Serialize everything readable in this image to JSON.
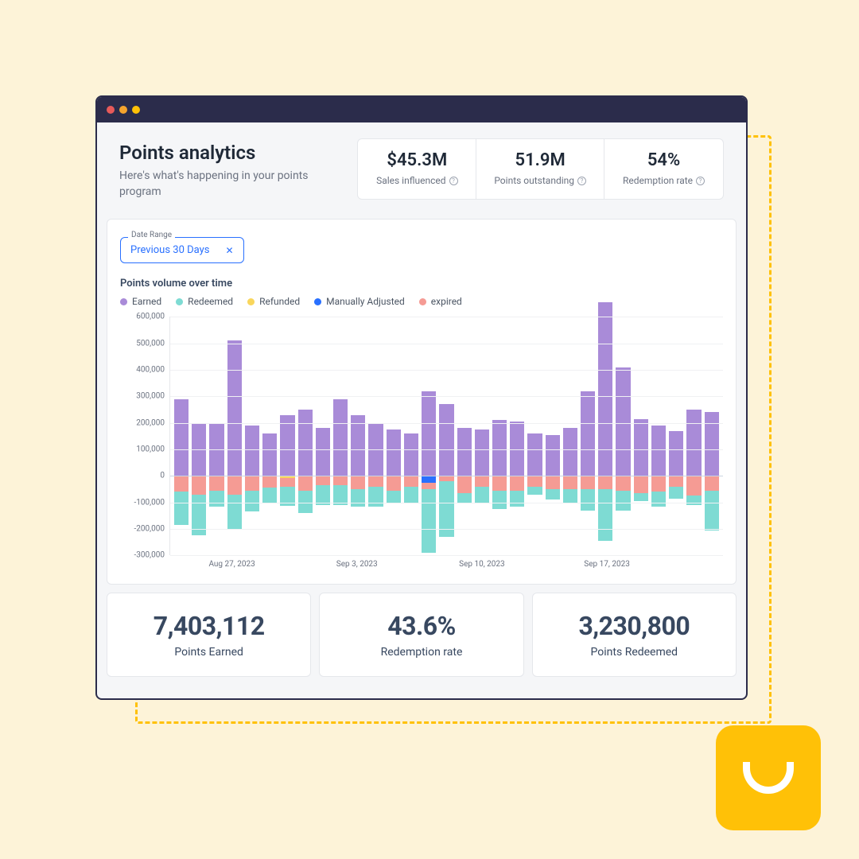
{
  "colors": {
    "earned": "#A98BD8",
    "redeemed": "#7EDBD3",
    "refunded": "#F9D65C",
    "adjusted": "#2970FF",
    "expired": "#F59B94",
    "dot_red": "#E75A5A",
    "dot_amber": "#F5A42E",
    "dot_yellow": "#FFC107"
  },
  "header": {
    "title": "Points analytics",
    "subtitle": "Here's what's happening in your points program"
  },
  "summary": [
    {
      "value": "$45.3M",
      "label": "Sales influenced"
    },
    {
      "value": "51.9M",
      "label": "Points outstanding"
    },
    {
      "value": "54%",
      "label": "Redemption rate"
    }
  ],
  "date_range": {
    "label": "Date Range",
    "value": "Previous 30 Days"
  },
  "chart_title": "Points volume over time",
  "legend": [
    {
      "name": "Earned",
      "color": "#A98BD8"
    },
    {
      "name": "Redeemed",
      "color": "#7EDBD3"
    },
    {
      "name": "Refunded",
      "color": "#F9D65C"
    },
    {
      "name": "Manually Adjusted",
      "color": "#2970FF"
    },
    {
      "name": "expired",
      "color": "#F59B94"
    }
  ],
  "chart_data": {
    "type": "bar",
    "title": "Points volume over time",
    "ylabel": "",
    "xlabel": "",
    "ylim": [
      -300000,
      600000
    ],
    "y_ticks": [
      600000,
      500000,
      400000,
      300000,
      200000,
      100000,
      0,
      -100000,
      -200000,
      -300000
    ],
    "y_tick_labels": [
      "600,000",
      "500,000",
      "400,000",
      "300,000",
      "200,000",
      "100,000",
      "0",
      "-100,000",
      "-200,000",
      "-300,000"
    ],
    "x_ticks": [
      {
        "index": 3,
        "label": "Aug 27, 2023"
      },
      {
        "index": 10,
        "label": "Sep 3, 2023"
      },
      {
        "index": 17,
        "label": "Sep 10, 2023"
      },
      {
        "index": 24,
        "label": "Sep 17, 2023"
      }
    ],
    "series": [
      {
        "name": "Earned",
        "color": "#A98BD8",
        "values": [
          290000,
          200000,
          200000,
          510000,
          190000,
          160000,
          230000,
          250000,
          180000,
          290000,
          230000,
          200000,
          175000,
          160000,
          320000,
          270000,
          180000,
          175000,
          210000,
          205000,
          160000,
          155000,
          180000,
          320000,
          655000,
          410000,
          215000,
          190000,
          170000,
          250000,
          240000
        ]
      },
      {
        "name": "Refunded",
        "color": "#F9D65C",
        "values": [
          0,
          0,
          0,
          0,
          0,
          0,
          -7000,
          0,
          0,
          0,
          0,
          0,
          0,
          0,
          0,
          0,
          0,
          0,
          0,
          0,
          0,
          0,
          0,
          0,
          0,
          0,
          0,
          0,
          0,
          0,
          0
        ]
      },
      {
        "name": "Manually Adjusted",
        "color": "#2970FF",
        "values": [
          0,
          0,
          0,
          0,
          0,
          0,
          0,
          0,
          0,
          0,
          0,
          0,
          0,
          0,
          -25000,
          0,
          0,
          0,
          0,
          0,
          0,
          0,
          0,
          0,
          0,
          0,
          0,
          0,
          0,
          0,
          0
        ]
      },
      {
        "name": "expired",
        "color": "#F59B94",
        "values": [
          -60000,
          -70000,
          -55000,
          -70000,
          -55000,
          -45000,
          -35000,
          -55000,
          -35000,
          -35000,
          -50000,
          -40000,
          -55000,
          -40000,
          -25000,
          -20000,
          -65000,
          -40000,
          -55000,
          -55000,
          -40000,
          -50000,
          -50000,
          -50000,
          -50000,
          -55000,
          -65000,
          -60000,
          -40000,
          -75000,
          -55000
        ]
      },
      {
        "name": "Redeemed",
        "color": "#7EDBD3",
        "values": [
          -125000,
          -155000,
          -60000,
          -130000,
          -80000,
          -60000,
          -70000,
          -85000,
          -75000,
          -75000,
          -65000,
          -75000,
          -50000,
          -60000,
          -240000,
          -210000,
          -35000,
          -60000,
          -70000,
          -60000,
          -30000,
          -40000,
          -55000,
          -80000,
          -195000,
          -75000,
          -30000,
          -55000,
          -45000,
          -35000,
          -150000
        ]
      }
    ]
  },
  "bottom_stats": [
    {
      "value": "7,403,112",
      "label": "Points Earned"
    },
    {
      "value": "43.6%",
      "label": "Redemption rate"
    },
    {
      "value": "3,230,800",
      "label": "Points Redeemed"
    }
  ]
}
